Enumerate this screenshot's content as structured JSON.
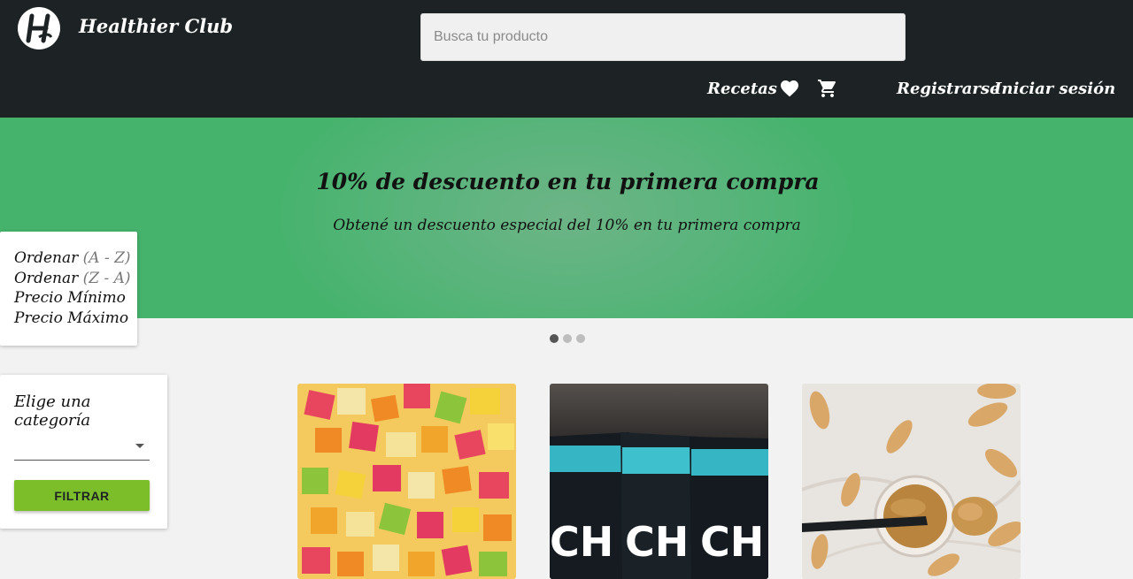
{
  "header": {
    "brand": "Healthier Club",
    "search_placeholder": "Busca tu producto",
    "nav": {
      "recipes": "Recetas",
      "register": "Registrarse",
      "login": "Iniciar sesión"
    }
  },
  "hero": {
    "title": "10% de descuento en tu primera compra",
    "subtitle": "Obtené un descuento especial del 10% en tu primera compra",
    "slides": 3,
    "active_slide": 1
  },
  "sort": {
    "items": [
      {
        "label": "Ordenar",
        "hint": "(A - Z)"
      },
      {
        "label": "Ordenar",
        "hint": "(Z - A)"
      },
      {
        "label": "Precio Mínimo",
        "hint": ""
      },
      {
        "label": "Precio Máximo",
        "hint": ""
      }
    ]
  },
  "category": {
    "title": "Elige una categoría",
    "selected": "",
    "button": "FILTRAR"
  },
  "colors": {
    "header_bg": "#1d2324",
    "hero_green": "#45b36c",
    "filter_button": "#7cbd2a"
  }
}
